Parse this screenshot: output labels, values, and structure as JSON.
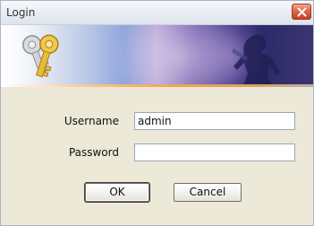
{
  "window": {
    "title": "Login",
    "close_icon": "close-icon"
  },
  "banner": {
    "icon": "keys-icon"
  },
  "form": {
    "username_label": "Username",
    "username_value": "admin",
    "password_label": "Password",
    "password_value": ""
  },
  "buttons": {
    "ok_label": "OK",
    "cancel_label": "Cancel"
  },
  "colors": {
    "dialog_background": "#ece9d8",
    "close_button": "#d9532f",
    "banner_dark": "#2d2a6b"
  }
}
